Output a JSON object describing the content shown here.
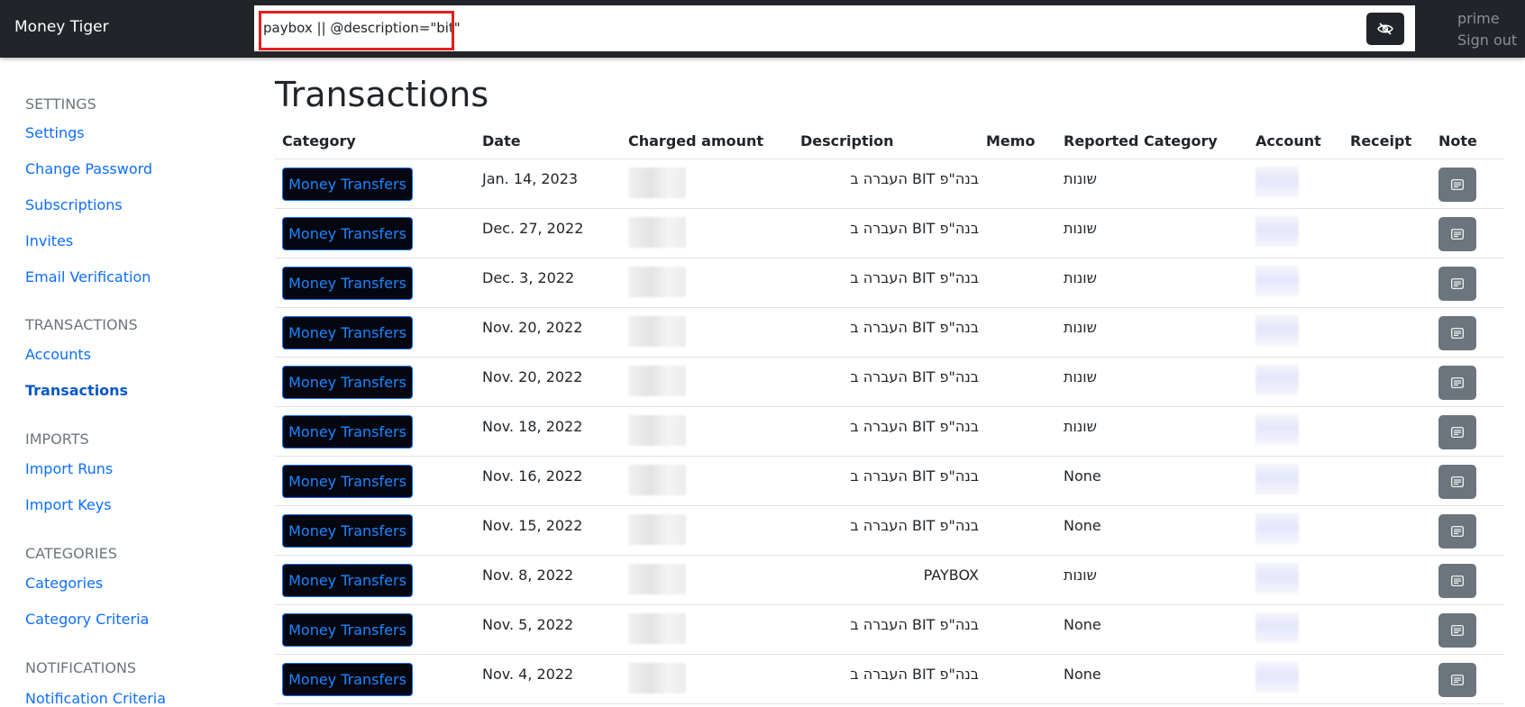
{
  "app": {
    "brand": "Money Tiger",
    "search_value": "paybox || @description=\"bit\"",
    "user": "prime",
    "sign_out": "Sign out"
  },
  "sidebar": {
    "sections": [
      {
        "heading": "SETTINGS",
        "items": [
          "Settings",
          "Change Password",
          "Subscriptions",
          "Invites",
          "Email Verification"
        ]
      },
      {
        "heading": "TRANSACTIONS",
        "items": [
          "Accounts",
          "Transactions"
        ]
      },
      {
        "heading": "IMPORTS",
        "items": [
          "Import Runs",
          "Import Keys"
        ]
      },
      {
        "heading": "CATEGORIES",
        "items": [
          "Categories",
          "Category Criteria"
        ]
      },
      {
        "heading": "NOTIFICATIONS",
        "items": [
          "Notification Criteria"
        ]
      }
    ],
    "active_item": "Transactions"
  },
  "main": {
    "title": "Transactions",
    "columns": [
      "Category",
      "Date",
      "Charged amount",
      "Description",
      "Memo",
      "Reported Category",
      "Account",
      "Receipt",
      "Note"
    ],
    "rows": [
      {
        "category": "Money Transfers",
        "date": "Jan. 14, 2023",
        "description": "בנה\"פ BIT העברה ב",
        "reported_category": "שונות"
      },
      {
        "category": "Money Transfers",
        "date": "Dec. 27, 2022",
        "description": "בנה\"פ BIT העברה ב",
        "reported_category": "שונות"
      },
      {
        "category": "Money Transfers",
        "date": "Dec. 3, 2022",
        "description": "בנה\"פ BIT העברה ב",
        "reported_category": "שונות"
      },
      {
        "category": "Money Transfers",
        "date": "Nov. 20, 2022",
        "description": "בנה\"פ BIT העברה ב",
        "reported_category": "שונות"
      },
      {
        "category": "Money Transfers",
        "date": "Nov. 20, 2022",
        "description": "בנה\"פ BIT העברה ב",
        "reported_category": "שונות"
      },
      {
        "category": "Money Transfers",
        "date": "Nov. 18, 2022",
        "description": "בנה\"פ BIT העברה ב",
        "reported_category": "שונות"
      },
      {
        "category": "Money Transfers",
        "date": "Nov. 16, 2022",
        "description": "בנה\"פ BIT העברה ב",
        "reported_category": "None"
      },
      {
        "category": "Money Transfers",
        "date": "Nov. 15, 2022",
        "description": "בנה\"פ BIT העברה ב",
        "reported_category": "None"
      },
      {
        "category": "Money Transfers",
        "date": "Nov. 8, 2022",
        "description": "PAYBOX",
        "reported_category": "שונות"
      },
      {
        "category": "Money Transfers",
        "date": "Nov. 5, 2022",
        "description": "בנה\"פ BIT העברה ב",
        "reported_category": "None"
      },
      {
        "category": "Money Transfers",
        "date": "Nov. 4, 2022",
        "description": "בנה\"פ BIT העברה ב",
        "reported_category": "None"
      }
    ]
  },
  "icons": {
    "visibility_toggle": "eye-slash-icon",
    "note": "note-icon"
  },
  "colors": {
    "navbar": "#212529",
    "link": "#0d6efd",
    "category_button_bg": "#050710",
    "note_button_bg": "#6c757d",
    "search_highlight": "#e41e1e"
  }
}
